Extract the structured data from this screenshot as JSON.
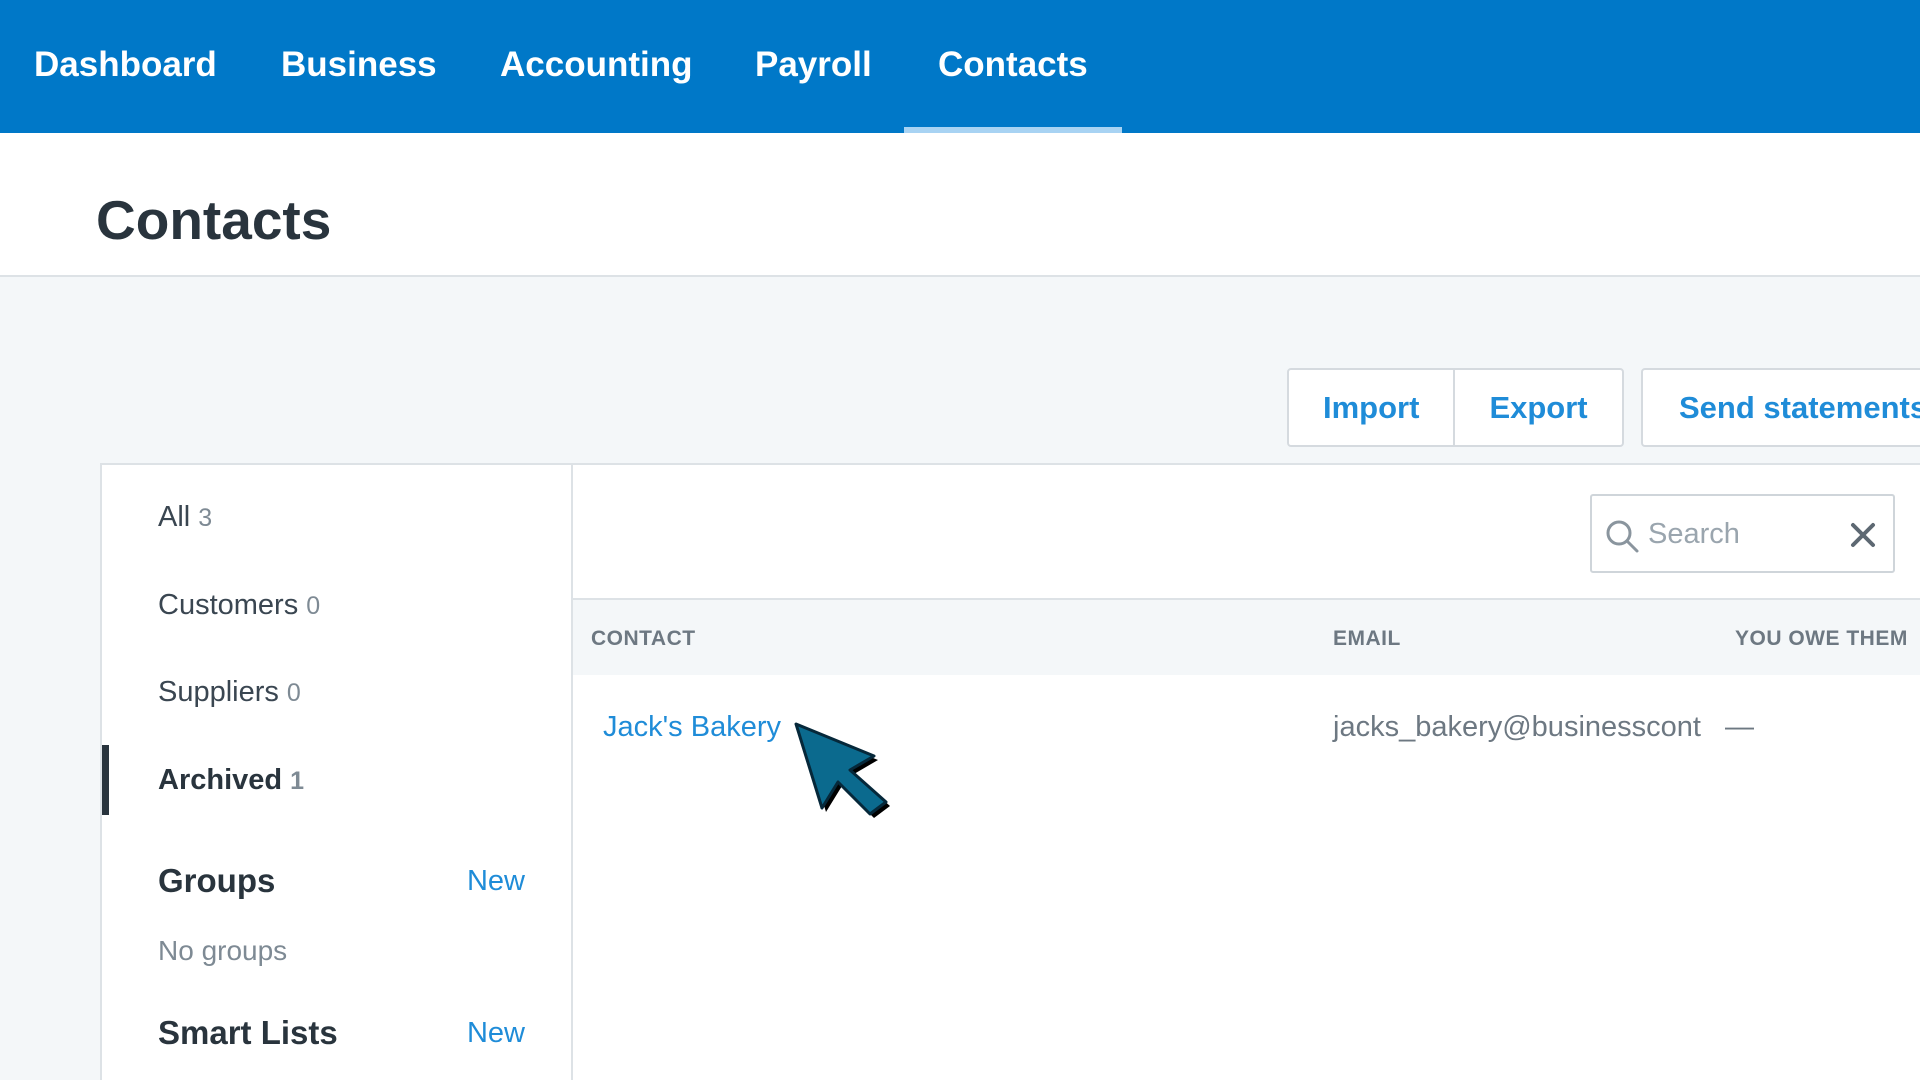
{
  "nav": {
    "items": [
      {
        "label": "Dashboard"
      },
      {
        "label": "Business"
      },
      {
        "label": "Accounting"
      },
      {
        "label": "Payroll"
      },
      {
        "label": "Contacts"
      }
    ],
    "active": "Contacts",
    "background_color": "#0078c8"
  },
  "page": {
    "title": "Contacts"
  },
  "actions": {
    "import_label": "Import",
    "export_label": "Export",
    "send_statements_label": "Send statements"
  },
  "sidebar": {
    "items": [
      {
        "label": "All",
        "count": "3"
      },
      {
        "label": "Customers",
        "count": "0"
      },
      {
        "label": "Suppliers",
        "count": "0"
      },
      {
        "label": "Archived",
        "count": "1"
      }
    ],
    "active_item": "Archived",
    "groups": {
      "heading": "Groups",
      "new_label": "New",
      "empty_text": "No groups"
    },
    "smart_lists": {
      "heading": "Smart Lists",
      "new_label": "New"
    }
  },
  "search": {
    "placeholder": "Search",
    "value": ""
  },
  "table": {
    "columns": [
      "CONTACT",
      "EMAIL",
      "YOU OWE THEM"
    ],
    "rows": [
      {
        "contact": "Jack's Bakery",
        "email": "jacks_bakery@businesscont",
        "you_owe_them": "—"
      }
    ]
  },
  "colors": {
    "accent": "#1f8cd8",
    "cursor": "#0b6a8e"
  }
}
